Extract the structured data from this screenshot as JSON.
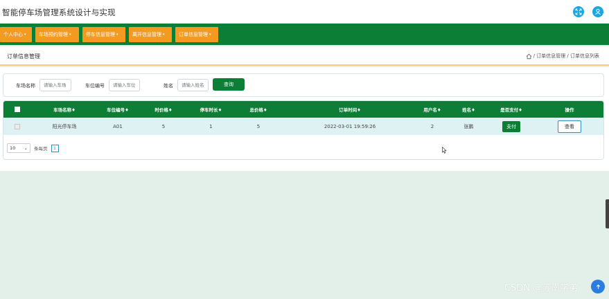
{
  "app": {
    "title": "智能停车场管理系统设计与实现"
  },
  "nav": {
    "items": [
      {
        "label": "个人中心"
      },
      {
        "label": "车场预约管理"
      },
      {
        "label": "停车信息管理"
      },
      {
        "label": "离开信息管理"
      },
      {
        "label": "订单信息管理"
      }
    ]
  },
  "breadcrumb": {
    "title": "订单信息管理",
    "sep1": "/",
    "level1": "订单信息管理",
    "sep2": "/",
    "level2": "订单信息列表"
  },
  "search": {
    "parking_name_label": "车场名称",
    "parking_name_placeholder": "请输入车场",
    "space_no_label": "车位编号",
    "space_no_placeholder": "请输入车位",
    "name_label": "姓名",
    "name_placeholder": "请输入姓名",
    "query_button": "查询"
  },
  "table": {
    "headers": [
      "车场名称",
      "车位编号",
      "时价格",
      "停车时长",
      "总价格",
      "订单时间",
      "用户名",
      "姓名",
      "是否支付",
      "操作"
    ],
    "rows": [
      {
        "parking_name": "阳光停车场",
        "space_no": "A01",
        "hourly_price": "5",
        "duration": "1",
        "total_price": "5",
        "order_time": "2022-03-01 19:59:26",
        "username": "2",
        "name": "张鹏",
        "pay_label": "支付",
        "view_label": "查看"
      }
    ]
  },
  "pager": {
    "page_size": "10",
    "per_page_label": "条每页",
    "current_page": "1"
  },
  "watermark": "CSDN @苏南学弟",
  "colors": {
    "primary_green": "#0d7e36",
    "nav_orange": "#f39a21",
    "accent_blue": "#18a7e6"
  },
  "icons": [
    "fullscreen-icon",
    "user-icon",
    "home-icon",
    "sort-icon",
    "chevron-down-icon",
    "cursor-icon"
  ]
}
